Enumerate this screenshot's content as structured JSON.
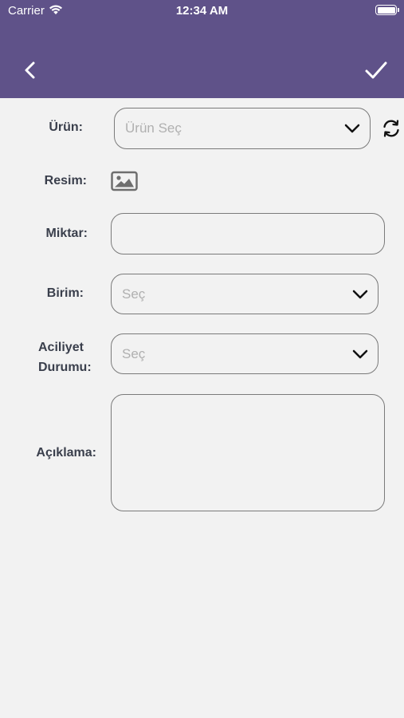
{
  "status_bar": {
    "carrier": "Carrier",
    "time": "12:34 AM"
  },
  "header": {
    "back_icon": "chevron-left-icon",
    "confirm_icon": "checkmark-icon",
    "color": "#5f5289"
  },
  "form": {
    "product": {
      "label": "Ürün:",
      "placeholder": "Ürün Seç"
    },
    "image": {
      "label": "Resim:"
    },
    "quantity": {
      "label": "Miktar:",
      "value": ""
    },
    "unit": {
      "label": "Birim:",
      "placeholder": "Seç"
    },
    "urgency": {
      "label_line1": "Aciliyet",
      "label_line2": "Durumu:",
      "placeholder": "Seç"
    },
    "description": {
      "label": "Açıklama:",
      "value": ""
    }
  }
}
